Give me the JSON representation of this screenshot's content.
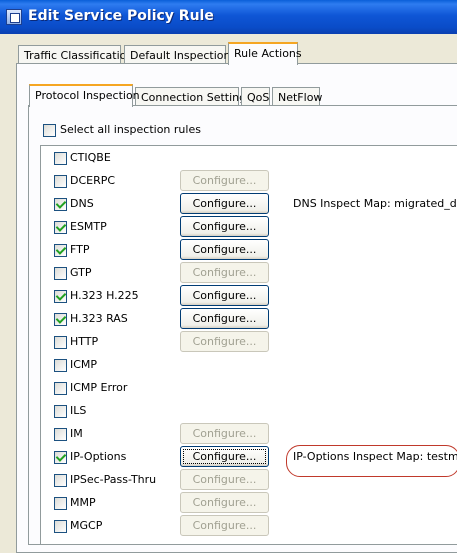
{
  "window": {
    "title": "Edit Service Policy Rule",
    "icon": "app-window-icon"
  },
  "top_tabs": [
    {
      "label": "Traffic Classification",
      "active": false
    },
    {
      "label": "Default Inspections",
      "active": false
    },
    {
      "label": "Rule Actions",
      "active": true
    }
  ],
  "sub_tabs": [
    {
      "label": "Protocol Inspection",
      "active": true
    },
    {
      "label": "Connection Settings",
      "active": false
    },
    {
      "label": "QoS",
      "active": false
    },
    {
      "label": "NetFlow",
      "active": false
    }
  ],
  "select_all": {
    "label": "Select all inspection rules",
    "checked": false
  },
  "configure_label": "Configure...",
  "inspections": [
    {
      "name": "CTIQBE",
      "checked": false,
      "configure": "none",
      "map": ""
    },
    {
      "name": "DCERPC",
      "checked": false,
      "configure": "disabled",
      "map": ""
    },
    {
      "name": "DNS",
      "checked": true,
      "configure": "enabled",
      "map": "DNS Inspect Map: migrated_dns_r"
    },
    {
      "name": "ESMTP",
      "checked": true,
      "configure": "enabled",
      "map": ""
    },
    {
      "name": "FTP",
      "checked": true,
      "configure": "enabled",
      "map": ""
    },
    {
      "name": "GTP",
      "checked": false,
      "configure": "disabled",
      "map": ""
    },
    {
      "name": "H.323 H.225",
      "checked": true,
      "configure": "enabled",
      "map": ""
    },
    {
      "name": "H.323 RAS",
      "checked": true,
      "configure": "enabled",
      "map": ""
    },
    {
      "name": "HTTP",
      "checked": false,
      "configure": "disabled",
      "map": ""
    },
    {
      "name": "ICMP",
      "checked": false,
      "configure": "none",
      "map": ""
    },
    {
      "name": "ICMP Error",
      "checked": false,
      "configure": "none",
      "map": ""
    },
    {
      "name": "ILS",
      "checked": false,
      "configure": "none",
      "map": ""
    },
    {
      "name": "IM",
      "checked": false,
      "configure": "disabled",
      "map": ""
    },
    {
      "name": "IP-Options",
      "checked": true,
      "configure": "enabled",
      "map": "IP-Options Inspect Map: testmap"
    },
    {
      "name": "IPSec-Pass-Thru",
      "checked": false,
      "configure": "disabled",
      "map": ""
    },
    {
      "name": "MMP",
      "checked": false,
      "configure": "disabled",
      "map": ""
    },
    {
      "name": "MGCP",
      "checked": false,
      "configure": "disabled",
      "map": ""
    }
  ]
}
